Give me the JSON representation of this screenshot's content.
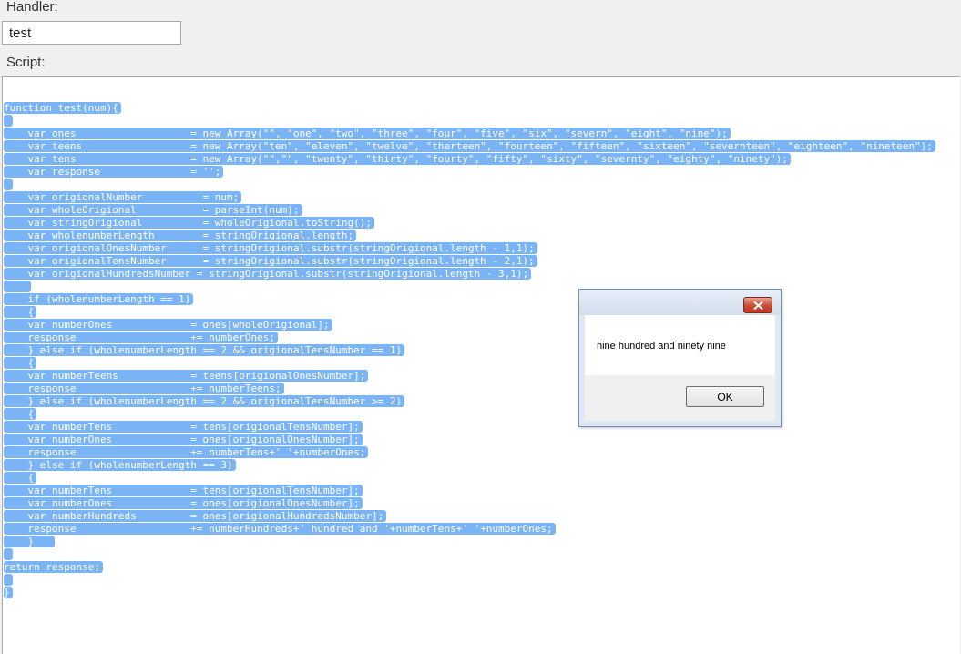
{
  "form": {
    "handler_label": "Handler:",
    "handler_value": "test",
    "script_label": "Script:"
  },
  "script": {
    "lines": [
      "function test(num){",
      " ",
      "    var ones                   = new Array(\"\", \"one\", \"two\", \"three\", \"four\", \"five\", \"six\", \"severn\", \"eight\", \"nine\");",
      "    var teens                  = new Array(\"ten\", \"eleven\", \"twelve\", \"therteen\", \"fourteen\", \"fifteen\", \"sixteen\", \"severnteen\", \"eighteen\", \"nineteen\");",
      "    var tens                   = new Array(\"\",\"\", \"twenty\", \"thirty\", \"fourty\", \"fifty\", \"sixty\", \"severnty\", \"eighty\", \"ninety\");",
      "    var response               = '';",
      " ",
      "    var origionalNumber          = num;",
      "    var wholeOrigional           = parseInt(num);",
      "    var stringOrigional          = wholeOrigional.toString();",
      "    var wholenumberLength        = stringOrigional.length;",
      "    var origionalOnesNumber      = stringOrigional.substr(stringOrigional.length - 1,1);",
      "    var origionalTensNumber      = stringOrigional.substr(stringOrigional.length - 2,1);",
      "    var origionalHundredsNumber = stringOrigional.substr(stringOrigional.length - 3,1);",
      "    ",
      "    if (wholenumberLength == 1)",
      "    {",
      "    var numberOnes             = ones[wholeOrigional];",
      "    response                   += numberOnes;",
      "    } else if (wholenumberLength == 2 && origionalTensNumber == 1)",
      "    {",
      "    var numberTeens            = teens[origionalOnesNumber];",
      "    response                   += numberTeens;",
      "    } else if (wholenumberLength == 2 && origionalTensNumber >= 2)",
      "    {",
      "    var numberTens             = tens[origionalTensNumber];",
      "    var numberOnes             = ones[origionalOnesNumber];",
      "    response                   += numberTens+' '+numberOnes;",
      "    } else if (wholenumberLength == 3)",
      "    {",
      "    var numberTens             = tens[origionalTensNumber];",
      "    var numberOnes             = ones[origionalOnesNumber];",
      "    var numberHundreds         = ones[origionalHundredsNumber];",
      "    response                   += numberHundreds+' hundred and '+numberTens+' '+numberOnes;",
      "    }   ",
      " ",
      "return response;",
      " ",
      "}"
    ]
  },
  "dialog": {
    "message": "nine hundred and ninety nine",
    "ok_label": "OK",
    "close_icon": "close-icon"
  },
  "colors": {
    "selection": "#7ab4f5",
    "close_button": "#c84a32"
  }
}
